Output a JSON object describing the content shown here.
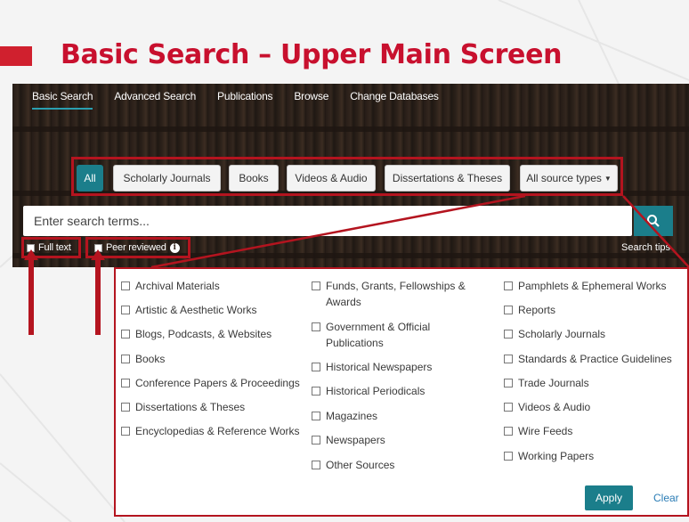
{
  "slide": {
    "title": "Basic Search – Upper Main Screen"
  },
  "nav": {
    "items": [
      "Basic Search",
      "Advanced Search",
      "Publications",
      "Browse",
      "Change Databases"
    ],
    "active": "Basic Search"
  },
  "source_types": {
    "buttons": [
      "All",
      "Scholarly Journals",
      "Books",
      "Videos & Audio",
      "Dissertations & Theses",
      "All source types"
    ],
    "active": "All"
  },
  "search": {
    "placeholder": "Enter search terms...",
    "full_text_label": "Full text",
    "peer_reviewed_label": "Peer reviewed",
    "search_tips": "Search tips"
  },
  "dropdown": {
    "columns": [
      [
        "Archival Materials",
        "Artistic & Aesthetic Works",
        "Blogs, Podcasts, & Websites",
        "Books",
        "Conference Papers & Proceedings",
        "Dissertations & Theses",
        "Encyclopedias & Reference Works"
      ],
      [
        "Funds, Grants, Fellowships & Awards",
        "Government & Official Publications",
        "Historical Newspapers",
        "Historical Periodicals",
        "Magazines",
        "Newspapers",
        "Other Sources"
      ],
      [
        "Pamphlets & Ephemeral Works",
        "Reports",
        "Scholarly Journals",
        "Standards & Practice Guidelines",
        "Trade Journals",
        "Videos & Audio",
        "Wire Feeds",
        "Working Papers"
      ]
    ],
    "apply_label": "Apply",
    "clear_label": "Clear"
  },
  "colors": {
    "brand_red": "#c8102e",
    "teal": "#1b7e8b",
    "highlight_red": "#b4141f"
  }
}
